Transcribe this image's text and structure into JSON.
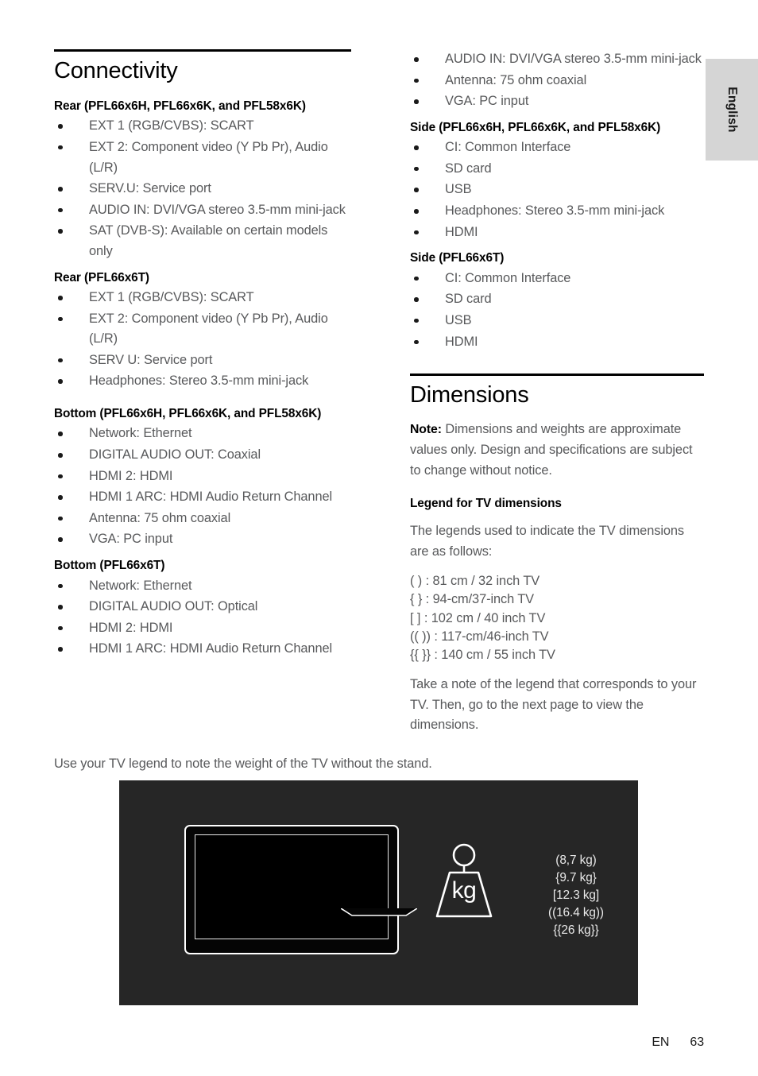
{
  "language_tab": {
    "label": "English"
  },
  "left_column": {
    "section_title": "Connectivity",
    "groups": [
      {
        "heading": "Rear (PFL66x6H, PFL66x6K, and PFL58x6K)",
        "items": [
          "EXT 1 (RGB/CVBS): SCART",
          "EXT 2: Component video (Y Pb Pr), Audio (L/R)",
          "SERV.U: Service port",
          "AUDIO IN: DVI/VGA stereo 3.5-mm mini-jack",
          "SAT (DVB-S): Available on certain models only"
        ]
      },
      {
        "heading": "Rear (PFL66x6T)",
        "items": [
          "EXT 1 (RGB/CVBS): SCART",
          "EXT 2: Component video (Y Pb Pr), Audio (L/R)",
          "SERV U: Service port",
          "Headphones: Stereo 3.5-mm mini-jack"
        ]
      },
      {
        "heading": "Bottom (PFL66x6H, PFL66x6K, and PFL58x6K)",
        "items": [
          "Network: Ethernet",
          "DIGITAL AUDIO OUT: Coaxial",
          "HDMI 2: HDMI",
          "HDMI 1 ARC: HDMI Audio Return Channel",
          "Antenna: 75 ohm coaxial",
          "VGA: PC input"
        ]
      },
      {
        "heading": "Bottom (PFL66x6T)",
        "items": [
          "Network: Ethernet",
          "DIGITAL AUDIO OUT: Optical",
          "HDMI 2: HDMI",
          "HDMI 1 ARC: HDMI Audio Return Channel"
        ]
      }
    ]
  },
  "right_column": {
    "continued_items": [
      "AUDIO IN: DVI/VGA stereo 3.5-mm mini-jack",
      "Antenna: 75 ohm coaxial",
      "VGA: PC input"
    ],
    "groups": [
      {
        "heading": "Side (PFL66x6H, PFL66x6K, and PFL58x6K)",
        "items": [
          "CI: Common Interface",
          "SD card",
          "USB",
          "Headphones: Stereo 3.5-mm mini-jack",
          "HDMI"
        ]
      },
      {
        "heading": "Side (PFL66x6T)",
        "items": [
          "CI: Common Interface",
          "SD card",
          "USB",
          "HDMI"
        ]
      }
    ],
    "dimensions": {
      "section_title": "Dimensions",
      "note_lead": "Note:",
      "note_text": " Dimensions and weights are approximate values only. Design and specifications are subject to change without notice.",
      "legend_heading": "Legend for TV dimensions",
      "legend_intro": "The legends used to indicate the TV dimensions are as follows:",
      "legend_lines": [
        "( ) : 81 cm / 32 inch TV",
        "{ } : 94-cm/37-inch TV",
        "[ ] : 102 cm / 40 inch TV",
        "(( )) : 117-cm/46-inch TV",
        "{{ }} : 140 cm / 55 inch TV"
      ],
      "closing_text": "Take a note of the legend that corresponds to your TV. Then, go to the next page to view the dimensions."
    }
  },
  "figure": {
    "caption": "Use your TV legend to note the weight of the TV without the stand.",
    "weight_icon_label": "kg",
    "weights": [
      "(8,7 kg)",
      "{9.7 kg}",
      "[12.3 kg]",
      "((16.4 kg))",
      "{{26 kg}}"
    ]
  },
  "footer": {
    "language_code": "EN",
    "page_number": "63"
  }
}
